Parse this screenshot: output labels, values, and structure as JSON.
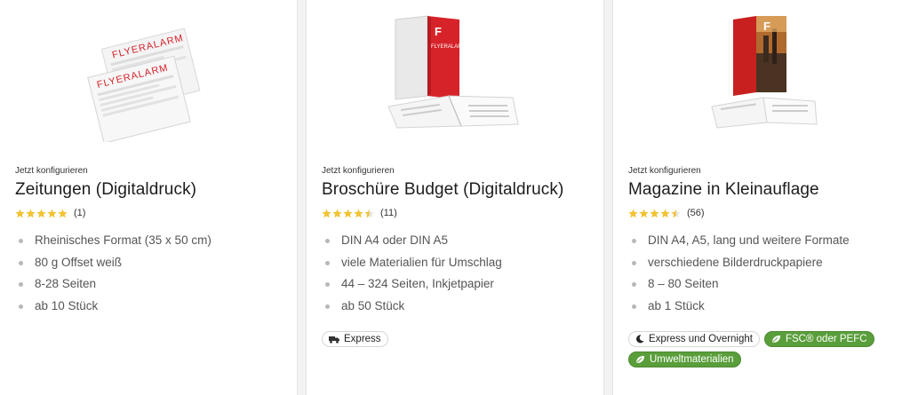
{
  "colors": {
    "star": "#f2c230",
    "eco_badge": "#5a9e3b",
    "brand_red": "#d6232a"
  },
  "products": [
    {
      "configure_label": "Jetzt konfigurieren",
      "title": "Zeitungen (Digitaldruck)",
      "rating_stars": 5,
      "rating_count": "(1)",
      "image_brand_text": "FLYERALARM",
      "features": [
        "Rheinisches Format (35 x 50 cm)",
        "80 g Offset weiß",
        "8-28 Seiten",
        "ab 10 Stück"
      ],
      "badges": []
    },
    {
      "configure_label": "Jetzt konfigurieren",
      "title": "Broschüre Budget (Digitaldruck)",
      "rating_stars": 4.5,
      "rating_count": "(11)",
      "image_brand_text": "FLYERALARM",
      "features": [
        "DIN A4 oder DIN A5",
        "viele Materialien für Umschlag",
        "44 – 324 Seiten, Inkjetpapier",
        "ab 50 Stück"
      ],
      "badges": [
        {
          "label": "Express",
          "icon": "truck-icon",
          "style": "light"
        }
      ]
    },
    {
      "configure_label": "Jetzt konfigurieren",
      "title": "Magazine in Kleinauflage",
      "rating_stars": 4.5,
      "rating_count": "(56)",
      "features": [
        "DIN A4, A5, lang und weitere Formate",
        "verschiedene Bilderdruckpapiere",
        "8 – 80 Seiten",
        "ab 1 Stück"
      ],
      "badges": [
        {
          "label": "Express und Overnight",
          "icon": "moon-icon",
          "style": "light"
        },
        {
          "label": "FSC® oder PEFC",
          "icon": "leaf-icon",
          "style": "green"
        },
        {
          "label": "Umweltmaterialien",
          "icon": "leaf-icon",
          "style": "green"
        }
      ]
    }
  ]
}
